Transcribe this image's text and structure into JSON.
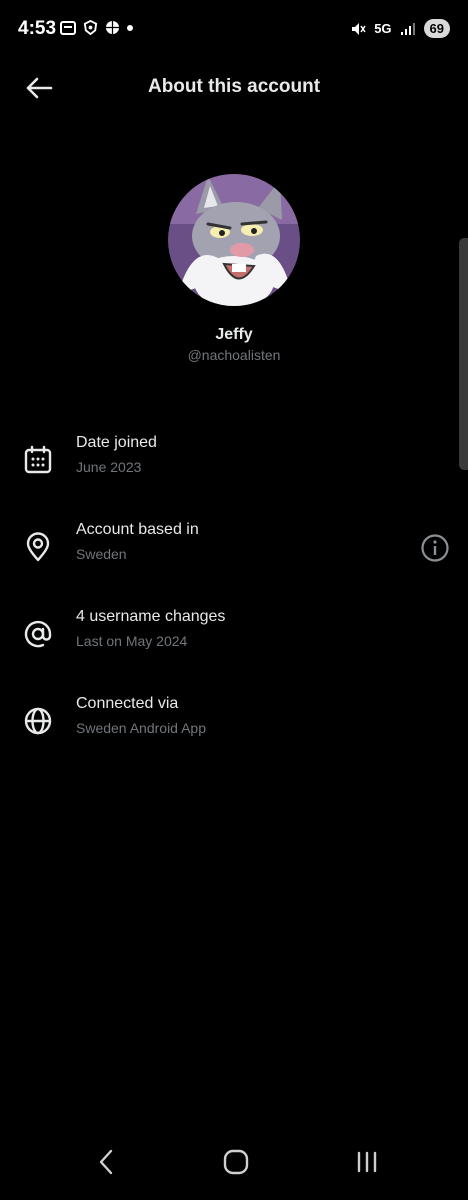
{
  "status_bar": {
    "time": "4:53",
    "network": "5G",
    "battery": "69"
  },
  "header": {
    "title": "About this account"
  },
  "profile": {
    "display_name": "Jeffy",
    "handle": "@nachoalisten"
  },
  "info_rows": [
    {
      "icon": "calendar-icon",
      "title": "Date joined",
      "subtitle": "June 2023"
    },
    {
      "icon": "location-pin-icon",
      "title": "Account based in",
      "subtitle": "Sweden"
    },
    {
      "icon": "at-sign-icon",
      "title": "4 username changes",
      "subtitle": "Last on May 2024"
    },
    {
      "icon": "globe-icon",
      "title": "Connected via",
      "subtitle": "Sweden Android App"
    }
  ],
  "colors": {
    "background": "#000000",
    "primary_text": "#e7e9ea",
    "secondary_text": "#71767b"
  }
}
